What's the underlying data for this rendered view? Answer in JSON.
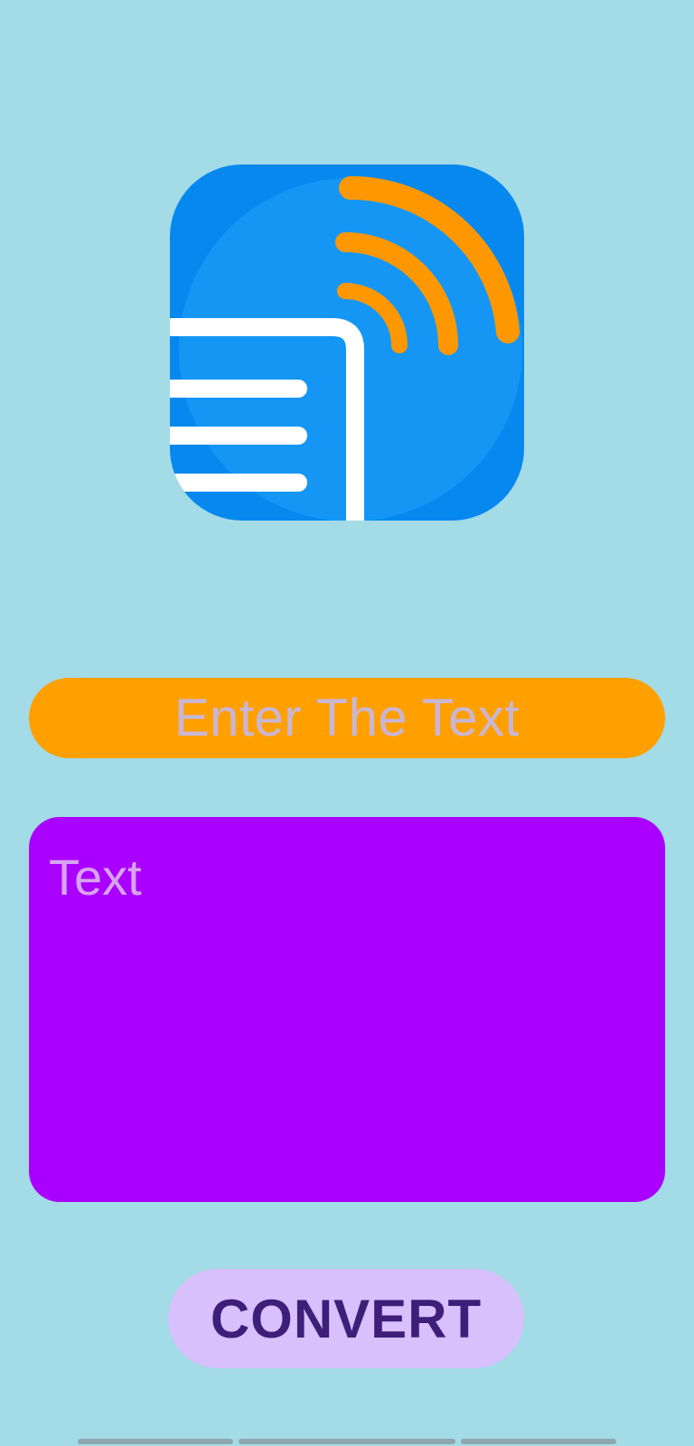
{
  "app": {
    "logo_icon": "text-to-speech-icon"
  },
  "form": {
    "header_label": "Enter The Text",
    "text_placeholder": "Text",
    "convert_label": "CONVERT"
  },
  "colors": {
    "background": "#a3dbe6",
    "header_pill": "#ffa000",
    "text_area": "#aa00ff",
    "button": "#d7c0fb",
    "button_text": "#3d1f7a",
    "logo_blue": "#0a8cf2",
    "logo_orange": "#ff9800"
  }
}
